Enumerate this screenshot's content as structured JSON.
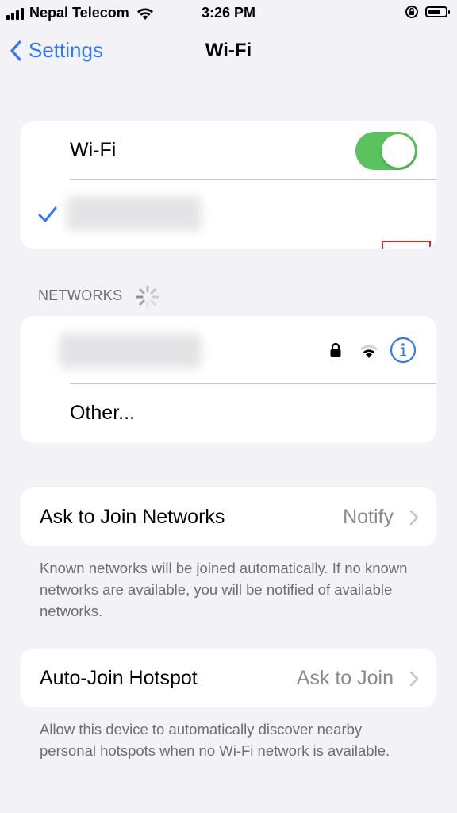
{
  "status_bar": {
    "carrier": "Nepal Telecom",
    "time": "3:26 PM",
    "battery_level": 0.75
  },
  "nav": {
    "back_label": "Settings",
    "title": "Wi-Fi"
  },
  "wifi_toggle": {
    "label": "Wi-Fi",
    "on": true
  },
  "connected_network": {
    "connected": true,
    "secured": true,
    "icons": [
      "checkmark-icon",
      "lock-icon",
      "wifi-signal-icon",
      "info-icon"
    ],
    "highlighted": true,
    "highlight_color": "#d52a2a"
  },
  "networks_section": {
    "header": "NETWORKS",
    "items": [
      {
        "secured": true,
        "icons": [
          "lock-icon",
          "wifi-signal-icon",
          "info-icon"
        ]
      }
    ],
    "other_label": "Other..."
  },
  "ask_to_join": {
    "label": "Ask to Join Networks",
    "value": "Notify",
    "footnote": "Known networks will be joined automatically. If no known networks are available, you will be notified of available networks."
  },
  "auto_join_hotspot": {
    "label": "Auto-Join Hotspot",
    "value": "Ask to Join",
    "footnote": "Allow this device to automatically discover nearby personal hotspots when no Wi-Fi network is available."
  },
  "colors": {
    "accent": "#3478f6",
    "toggle_on": "#5ac35e",
    "background": "#f2f2f7",
    "secondary_text": "#6d6d72"
  }
}
